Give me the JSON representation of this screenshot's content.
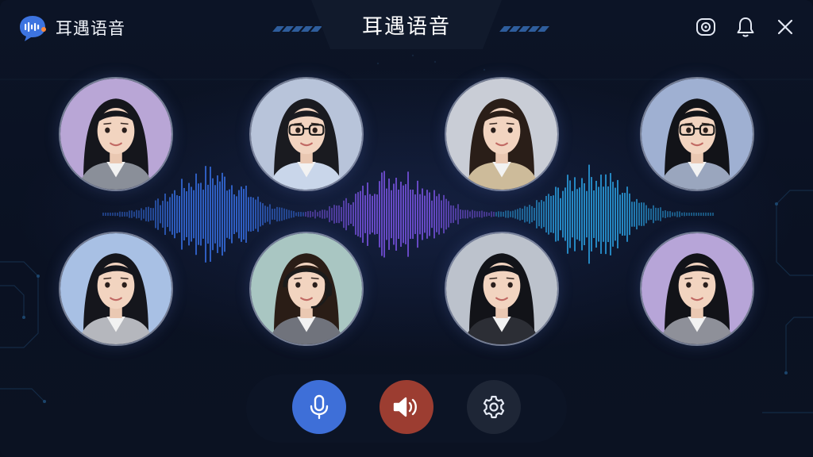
{
  "app": {
    "brand_name": "耳遇语音",
    "window_title": "耳遇语音"
  },
  "top_actions": [
    {
      "name": "record-button",
      "icon": "record-icon"
    },
    {
      "name": "notification-button",
      "icon": "bell-icon"
    },
    {
      "name": "close-button",
      "icon": "close-icon"
    }
  ],
  "participants": [
    {
      "id": 1,
      "bg": "#b9a6d6",
      "hair": "#15161c",
      "outfit": "#8a8f99",
      "glasses": false,
      "headset": false
    },
    {
      "id": 2,
      "bg": "#b8c4da",
      "hair": "#1a1b20",
      "outfit": "#c9d6ea",
      "glasses": true,
      "headset": false
    },
    {
      "id": 3,
      "bg": "#c9cdd6",
      "hair": "#2a1e18",
      "outfit": "#cdbb9a",
      "glasses": false,
      "headset": false
    },
    {
      "id": 4,
      "bg": "#9fb0d2",
      "hair": "#121318",
      "outfit": "#9aa6be",
      "glasses": true,
      "headset": false
    },
    {
      "id": 5,
      "bg": "#a8c0e4",
      "hair": "#15161c",
      "outfit": "#b5b7bd",
      "glasses": false,
      "headset": false
    },
    {
      "id": 6,
      "bg": "#a9c6c2",
      "hair": "#2a1d16",
      "outfit": "#70737c",
      "glasses": false,
      "headset": true
    },
    {
      "id": 7,
      "bg": "#bcc2cc",
      "hair": "#121318",
      "outfit": "#2c2e35",
      "glasses": false,
      "headset": false
    },
    {
      "id": 8,
      "bg": "#b7a5d8",
      "hair": "#121318",
      "outfit": "#8e9099",
      "glasses": false,
      "headset": false
    }
  ],
  "controls": {
    "mic": {
      "icon": "microphone-icon",
      "color": "#3e6fd8"
    },
    "speaker": {
      "icon": "speaker-icon",
      "color": "#9c3d31"
    },
    "settings": {
      "icon": "gear-icon",
      "color": "#1e2636"
    }
  },
  "colors": {
    "background": "#0a1120",
    "wave_blue": "#3c7cff",
    "wave_purple": "#8a5cff",
    "wave_cyan": "#2fb6ff"
  }
}
